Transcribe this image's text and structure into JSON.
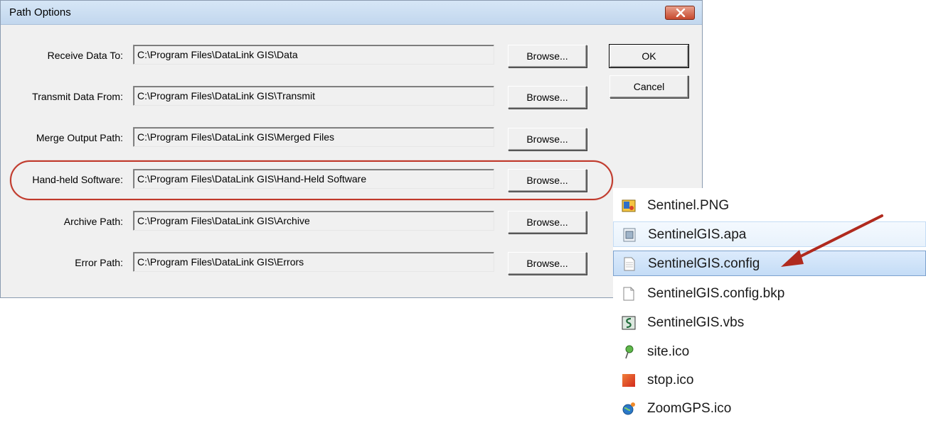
{
  "dialog": {
    "title": "Path Options",
    "ok_label": "OK",
    "cancel_label": "Cancel",
    "browse_label": "Browse...",
    "rows": [
      {
        "label": "Receive Data To:",
        "value": "C:\\Program Files\\DataLink GIS\\Data"
      },
      {
        "label": "Transmit Data From:",
        "value": "C:\\Program Files\\DataLink GIS\\Transmit"
      },
      {
        "label": "Merge Output Path:",
        "value": "C:\\Program Files\\DataLink GIS\\Merged Files"
      },
      {
        "label": "Hand-held Software:",
        "value": "C:\\Program Files\\DataLink GIS\\Hand-Held Software"
      },
      {
        "label": "Archive Path:",
        "value": "C:\\Program Files\\DataLink GIS\\Archive"
      },
      {
        "label": "Error Path:",
        "value": "C:\\Program Files\\DataLink GIS\\Errors"
      }
    ],
    "highlighted_row": "Hand-held Software:",
    "highlight_color": "#c0392b"
  },
  "files": [
    {
      "name": "Sentinel.PNG",
      "icon": "png-image-icon",
      "state": "normal"
    },
    {
      "name": "SentinelGIS.apa",
      "icon": "apa-file-icon",
      "state": "hover"
    },
    {
      "name": "SentinelGIS.config",
      "icon": "config-file-icon",
      "state": "selected"
    },
    {
      "name": "SentinelGIS.config.bkp",
      "icon": "blank-file-icon",
      "state": "normal"
    },
    {
      "name": "SentinelGIS.vbs",
      "icon": "vbs-script-icon",
      "state": "normal"
    },
    {
      "name": "site.ico",
      "icon": "green-pin-icon",
      "state": "normal"
    },
    {
      "name": "stop.ico",
      "icon": "red-square-icon",
      "state": "normal"
    },
    {
      "name": "ZoomGPS.ico",
      "icon": "globe-icon",
      "state": "normal"
    }
  ],
  "arrow_color": "#c0392b",
  "arrow_target": "SentinelGIS.config"
}
